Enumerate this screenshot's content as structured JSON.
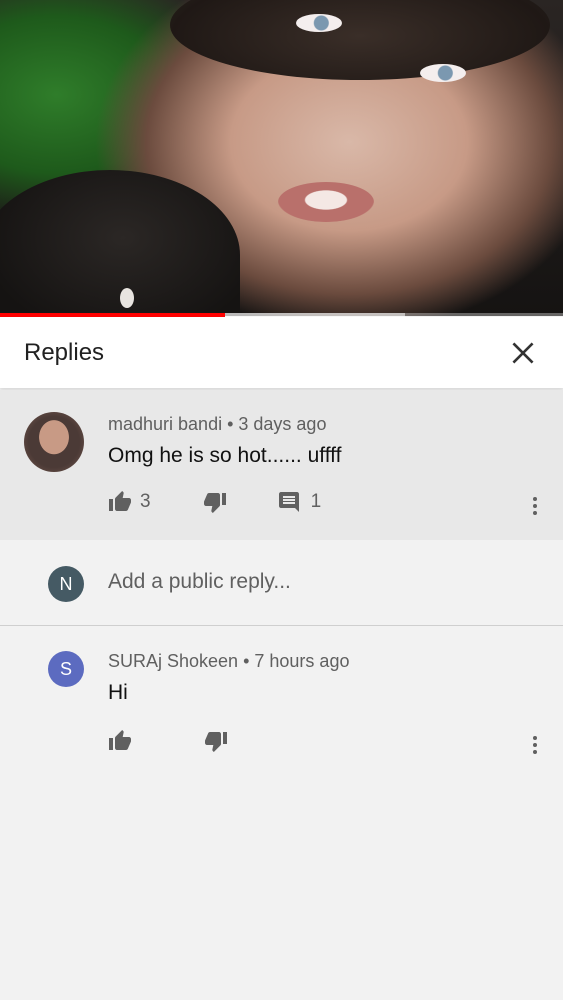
{
  "video": {
    "progress_played_fraction": 0.4,
    "progress_loaded_fraction": 0.72,
    "colors": {
      "played": "#ff0000"
    }
  },
  "header": {
    "title": "Replies",
    "close_icon": "close-icon"
  },
  "parent_comment": {
    "author": "madhuri bandi",
    "time": "3 days ago",
    "text": "Omg he is so hot...... uffff",
    "likes": "3",
    "replies": "1",
    "avatar": "profile-photo"
  },
  "reply_input": {
    "avatar_letter": "N",
    "avatar_color": "#455a64",
    "placeholder": "Add a public reply..."
  },
  "replies": [
    {
      "author": "SURAj Shokeen",
      "time": "7 hours ago",
      "text": "Hi",
      "avatar_letter": "S",
      "avatar_color": "#5c6bc0"
    }
  ],
  "separator": " • "
}
